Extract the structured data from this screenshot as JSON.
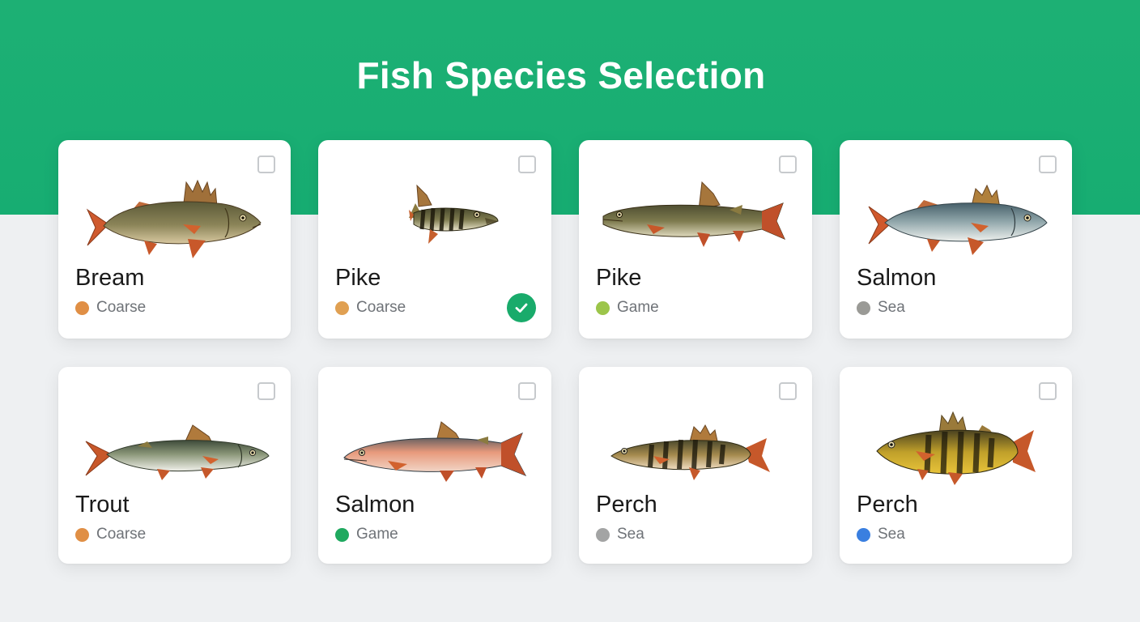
{
  "page": {
    "title": "Fish Species Selection",
    "accent_color": "#1db074"
  },
  "cards": [
    {
      "name": "Bream",
      "category": "Coarse",
      "dot_color": "#e08f45",
      "selected": false,
      "fish": "perch-like-fish"
    },
    {
      "name": "Pike",
      "category": "Coarse",
      "dot_color": "#e0a052",
      "selected": true,
      "fish": "striped-pike-fish"
    },
    {
      "name": "Pike",
      "category": "Game",
      "dot_color": "#9cc54a",
      "selected": false,
      "fish": "pike-fish"
    },
    {
      "name": "Salmon",
      "category": "Sea",
      "dot_color": "#9a9a96",
      "selected": false,
      "fish": "perch-like-fish"
    },
    {
      "name": "Trout",
      "category": "Coarse",
      "dot_color": "#e08f45",
      "selected": false,
      "fish": "trout-fish"
    },
    {
      "name": "Salmon",
      "category": "Game",
      "dot_color": "#1fa95f",
      "selected": false,
      "fish": "salmon-fish"
    },
    {
      "name": "Perch",
      "category": "Sea",
      "dot_color": "#a3a4a4",
      "selected": false,
      "fish": "striped-perch-fish"
    },
    {
      "name": "Perch",
      "category": "Sea",
      "dot_color": "#3a7fe0",
      "selected": false,
      "fish": "yellow-perch-fish"
    }
  ]
}
